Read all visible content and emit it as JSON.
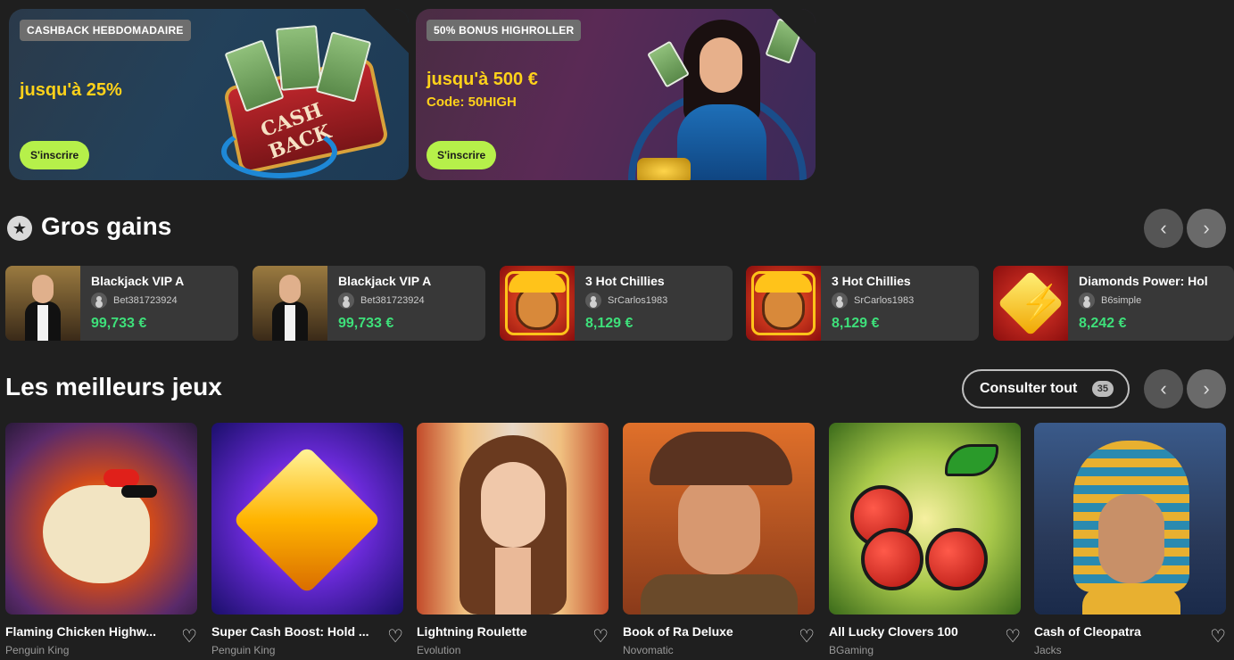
{
  "promos": [
    {
      "badge": "CASHBACK HEBDOMADAIRE",
      "headline": "jusqu'à 25%",
      "sub": "",
      "cta": "S'inscrire",
      "art_text": "CASH BACK"
    },
    {
      "badge": "50% BONUS HIGHROLLER",
      "headline": "jusqu'à 500 €",
      "sub": "Code: 50HIGH",
      "cta": "S'inscrire"
    }
  ],
  "big_wins": {
    "title": "Gros gains",
    "prev_icon": "‹",
    "next_icon": "›",
    "items": [
      {
        "game": "Blackjack VIP A",
        "user": "Bet381723924",
        "amount": "99,733 €"
      },
      {
        "game": "Blackjack VIP A",
        "user": "Bet381723924",
        "amount": "99,733 €"
      },
      {
        "game": "3 Hot Chillies",
        "user": "SrCarlos1983",
        "amount": "8,129 €"
      },
      {
        "game": "3 Hot Chillies",
        "user": "SrCarlos1983",
        "amount": "8,129 €"
      },
      {
        "game": "Diamonds Power: Hol",
        "user": "B6simple",
        "amount": "8,242 €"
      }
    ]
  },
  "best_games": {
    "title": "Les meilleurs jeux",
    "view_all": "Consulter tout",
    "count": "35",
    "prev_icon": "‹",
    "next_icon": "›",
    "heart_icon": "♡",
    "items": [
      {
        "name": "Flaming Chicken Highw...",
        "provider": "Penguin King"
      },
      {
        "name": "Super Cash Boost: Hold ...",
        "provider": "Penguin King"
      },
      {
        "name": "Lightning Roulette",
        "provider": "Evolution"
      },
      {
        "name": "Book of Ra Deluxe",
        "provider": "Novomatic"
      },
      {
        "name": "All Lucky Clovers 100",
        "provider": "BGaming"
      },
      {
        "name": "Cash of Cleopatra",
        "provider": "Jacks"
      }
    ]
  },
  "colors": {
    "accent": "#b6f04a",
    "promo_text": "#ffd21a",
    "win_amount": "#3ee07a",
    "background": "#1f1f1f"
  }
}
